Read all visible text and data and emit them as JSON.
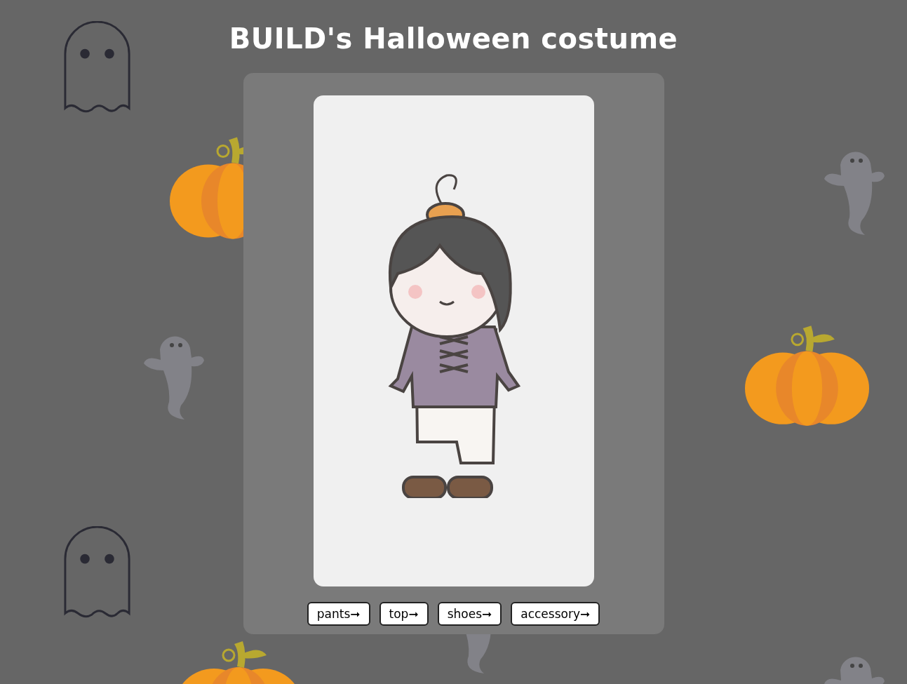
{
  "title": "BUILD's Halloween costume",
  "buttons": [
    {
      "label": "pants➞"
    },
    {
      "label": "top➞"
    },
    {
      "label": "shoes➞"
    },
    {
      "label": "accessory➞"
    }
  ]
}
